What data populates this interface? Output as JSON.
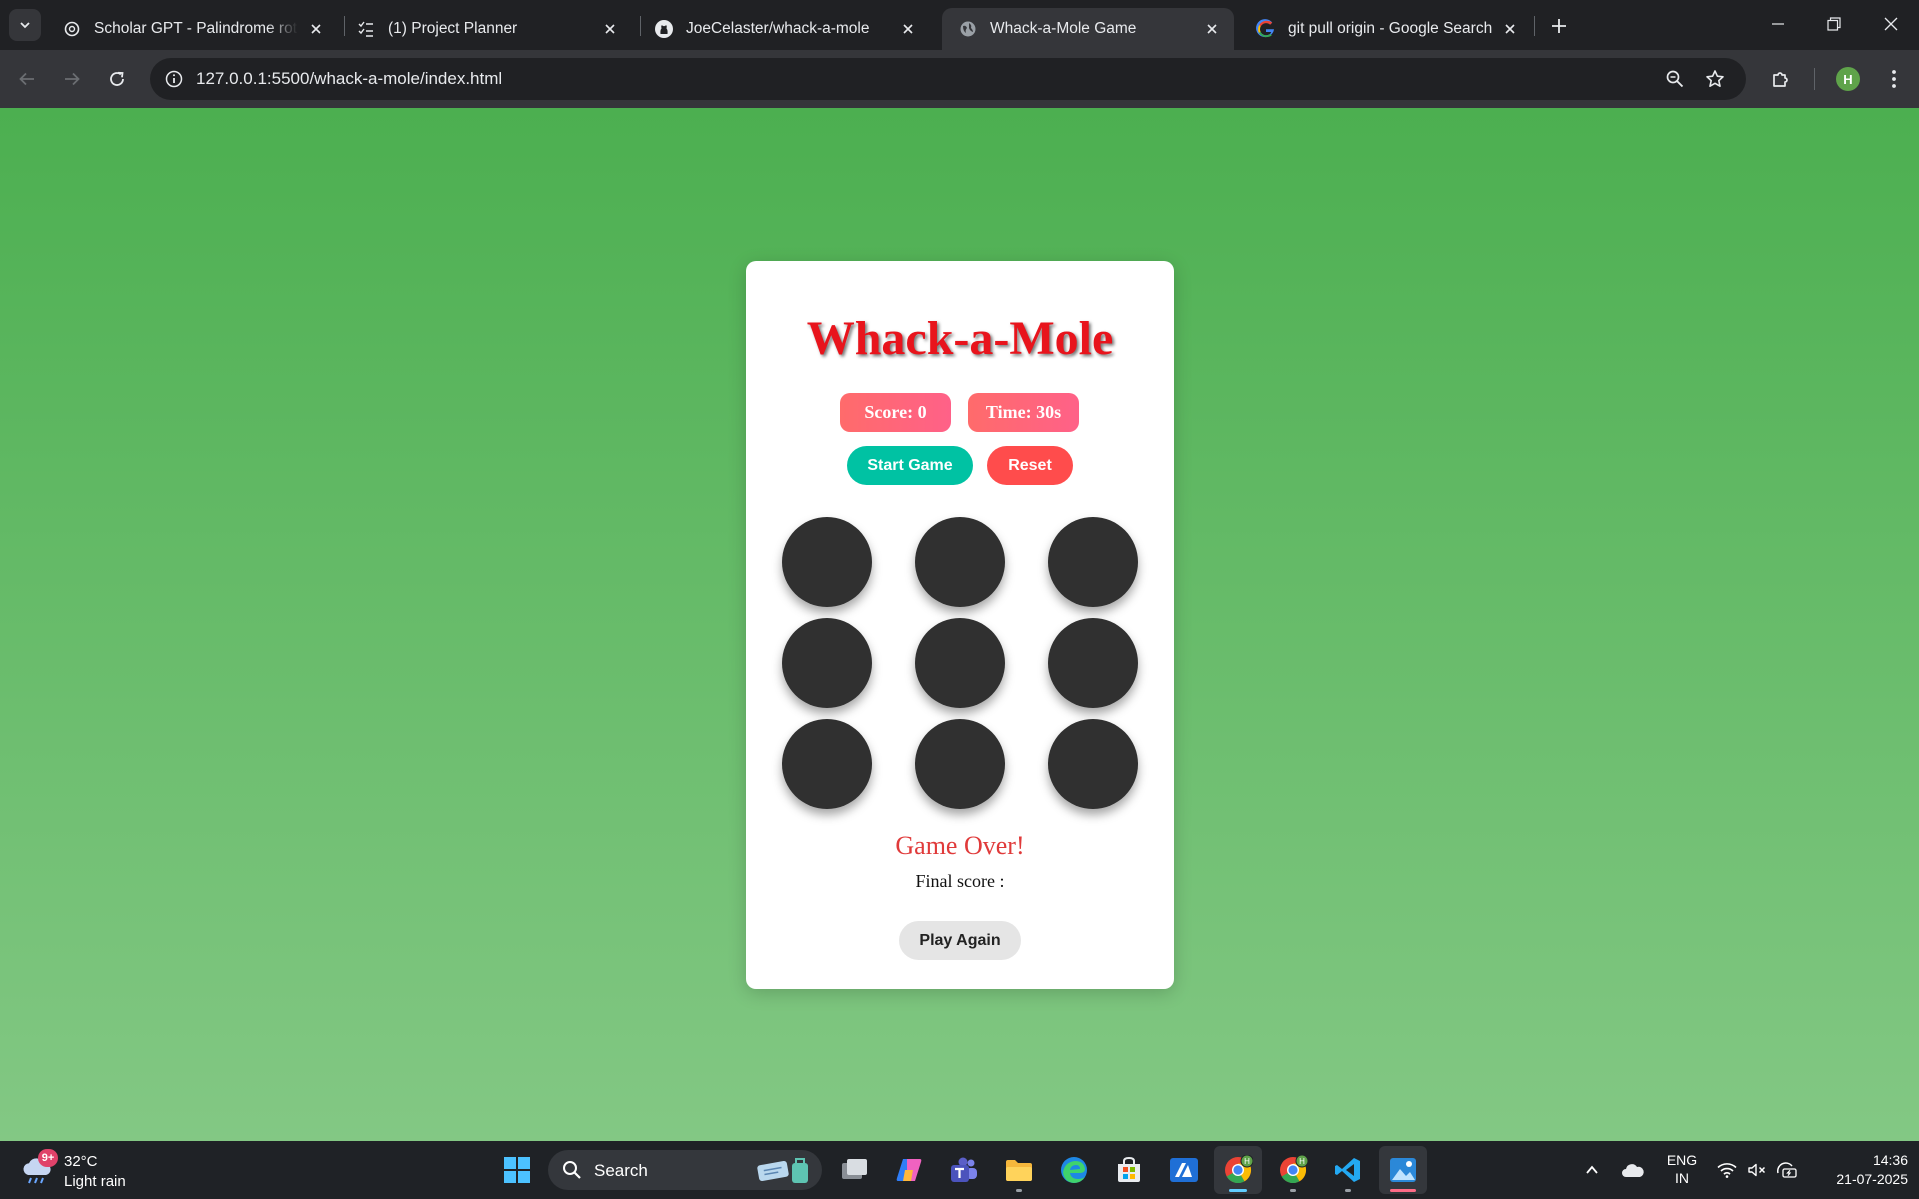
{
  "browser": {
    "tabs": [
      {
        "title": "Scholar GPT - Palindrome rotati",
        "icon": "openai-icon",
        "active": false
      },
      {
        "title": "(1) Project Planner",
        "icon": "checklist-icon",
        "active": false
      },
      {
        "title": "JoeCelaster/whack-a-mole",
        "icon": "github-icon",
        "active": false
      },
      {
        "title": "Whack-a-Mole Game",
        "icon": "globe-icon",
        "active": true
      },
      {
        "title": "git pull origin - Google Search",
        "icon": "google-icon",
        "active": false
      }
    ],
    "url": "127.0.0.1:5500/whack-a-mole/index.html",
    "profile_initial": "H"
  },
  "game": {
    "title": "Whack-a-Mole",
    "score_text": "Score: 0",
    "time_text": "Time: 30s",
    "start_label": "Start Game",
    "reset_label": "Reset",
    "game_over_text": "Game Over!",
    "final_score_text": "Final score :",
    "play_again_label": "Play Again",
    "hole_count": 9
  },
  "taskbar": {
    "weather_temp": "32°C",
    "weather_desc": "Light rain",
    "weather_badge": "9+",
    "search_label": "Search",
    "language_line1": "ENG",
    "language_line2": "IN",
    "time": "14:36",
    "date": "21-07-2025"
  },
  "colors": {
    "page_gradient_top": "#4caf50",
    "page_gradient_bottom": "#83c884",
    "title_red": "#e8141c",
    "start_teal": "#00c2a3",
    "reset_red": "#ff4c4c",
    "hole": "#303030"
  }
}
